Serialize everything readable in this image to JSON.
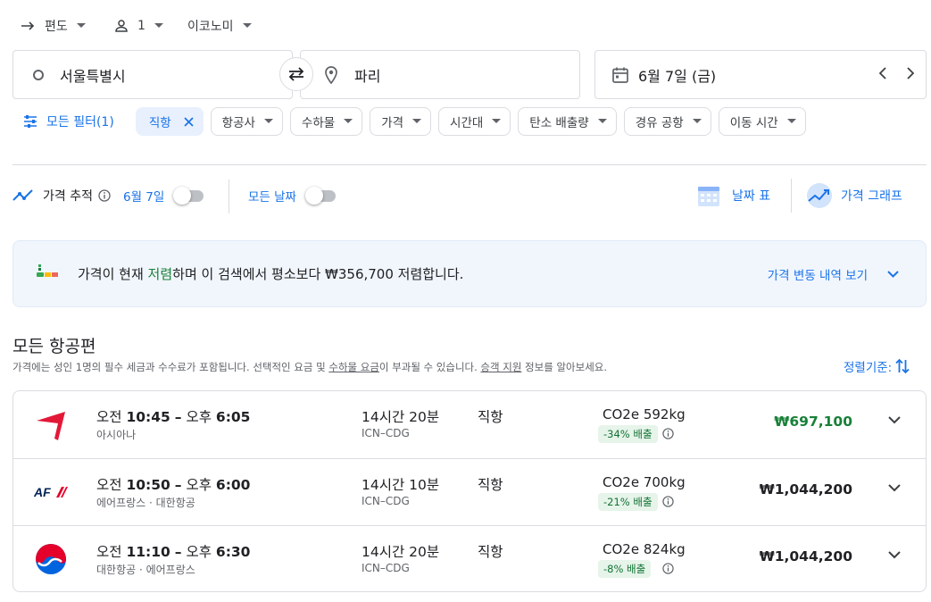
{
  "trip": {
    "type_label": "편도",
    "passengers": "1",
    "cabin": "이코노미"
  },
  "search": {
    "origin": "서울특별시",
    "destination": "파리",
    "date": "6월 7일 (금)"
  },
  "filters": {
    "all_filters": "모든 필터(1)",
    "chips": [
      "직항",
      "항공사",
      "수하물",
      "가격",
      "시간대",
      "탄소 배출량",
      "경유 공항",
      "이동 시간"
    ]
  },
  "tracking": {
    "price_track_label": "가격 추적",
    "date_label": "6월 7일",
    "all_dates_label": "모든 날짜",
    "date_grid": "날짜 표",
    "price_graph": "가격 그래프"
  },
  "banner": {
    "text_before": "가격이 현재 ",
    "highlight": "저렴",
    "text_after": "하며 이 검색에서 평소보다 ₩356,700 저렴합니다.",
    "history_link": "가격 변동 내역 보기",
    "colors": {
      "highlight": "#188038"
    }
  },
  "results_header": {
    "title": "모든 항공편",
    "note_prefix": "가격에는 성인 1명의 필수 세금과 수수료가 포함됩니다. 선택적인 요금 및 ",
    "note_link1": "수하물 요금",
    "note_middle": "이 부과될 수 있습니다. ",
    "note_link2": "승객 지원",
    "note_suffix": " 정보를 알아보세요.",
    "sort_label": "정렬기준:"
  },
  "flights": [
    {
      "logo": "asiana-logo",
      "depart_prefix": "오전",
      "depart": "10:45",
      "sep": "–",
      "arrive_prefix": "오후",
      "arrive": "6:05",
      "airline": "아시아나",
      "duration": "14시간 20분",
      "route": "ICN–CDG",
      "stops": "직항",
      "co2": "CO2e 592kg",
      "emission": "-34% 배출",
      "price": "₩697,100"
    },
    {
      "logo": "airfrance-logo",
      "depart_prefix": "오전",
      "depart": "10:50",
      "sep": "–",
      "arrive_prefix": "오후",
      "arrive": "6:00",
      "airline": "에어프랑스 · 대한항공",
      "duration": "14시간 10분",
      "route": "ICN–CDG",
      "stops": "직항",
      "co2": "CO2e 700kg",
      "emission": "-21% 배출",
      "price": "₩1,044,200"
    },
    {
      "logo": "koreanair-logo",
      "depart_prefix": "오전",
      "depart": "11:10",
      "sep": "–",
      "arrive_prefix": "오후",
      "arrive": "6:30",
      "airline": "대한항공 · 에어프랑스",
      "duration": "14시간 20분",
      "route": "ICN–CDG",
      "stops": "직항",
      "co2": "CO2e 824kg",
      "emission": "-8% 배출",
      "price": "₩1,044,200"
    }
  ],
  "af_logo_text": "AF",
  "colors": {
    "accent": "#1a73e8",
    "cheap_price": "#188038",
    "emission_bg": "#e6f4ea"
  }
}
